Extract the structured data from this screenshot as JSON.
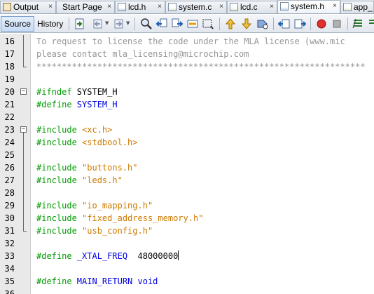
{
  "tabs": [
    {
      "label": "Output",
      "icon": "output-window-icon",
      "active": false
    },
    {
      "label": "Start Page",
      "icon": "",
      "active": false
    },
    {
      "label": "lcd.h",
      "icon": "header-file-icon",
      "active": false
    },
    {
      "label": "system.c",
      "icon": "c-file-icon",
      "active": false
    },
    {
      "label": "lcd.c",
      "icon": "c-file-icon",
      "active": false
    },
    {
      "label": "system.h",
      "icon": "header-file-icon",
      "active": true
    },
    {
      "label": "app_",
      "icon": "c-file-icon",
      "active": false
    }
  ],
  "tab_close_glyph": "×",
  "toolbar": {
    "source_label": "Source",
    "history_label": "History",
    "buttons": [
      "last-edit-icon",
      "back-icon",
      "forward-icon",
      "find-icon",
      "find-previous-icon",
      "find-next-icon",
      "find-selection-icon",
      "toggle-highlight-icon",
      "previous-bookmark-icon",
      "next-bookmark-icon",
      "toggle-bookmark-icon",
      "shift-left-icon",
      "shift-right-icon",
      "start-macro-icon",
      "stop-macro-icon",
      "comment-icon"
    ]
  },
  "editor": {
    "lines": [
      {
        "n": "16",
        "tokens": [
          {
            "t": "cmt",
            "v": "To request to license the code under the MLA license (www.mic"
          }
        ]
      },
      {
        "n": "17",
        "tokens": [
          {
            "t": "cmt",
            "v": "please contact mla_licensing@microchip.com"
          }
        ]
      },
      {
        "n": "18",
        "tokens": [
          {
            "t": "cmt",
            "v": "*****************************************************************"
          }
        ],
        "fold": "end"
      },
      {
        "n": "19",
        "tokens": []
      },
      {
        "n": "20",
        "tokens": [
          {
            "t": "pp",
            "v": "#ifndef "
          },
          {
            "t": "id",
            "v": "SYSTEM_H"
          }
        ],
        "fold": "start"
      },
      {
        "n": "21",
        "tokens": [
          {
            "t": "pp",
            "v": "#define "
          },
          {
            "t": "mac",
            "v": "SYSTEM_H"
          }
        ]
      },
      {
        "n": "22",
        "tokens": []
      },
      {
        "n": "23",
        "tokens": [
          {
            "t": "pp",
            "v": "#include "
          },
          {
            "t": "str",
            "v": "<xc.h>"
          }
        ],
        "fold": "start"
      },
      {
        "n": "24",
        "tokens": [
          {
            "t": "pp",
            "v": "#include "
          },
          {
            "t": "str",
            "v": "<stdbool.h>"
          }
        ]
      },
      {
        "n": "25",
        "tokens": []
      },
      {
        "n": "26",
        "tokens": [
          {
            "t": "pp",
            "v": "#include "
          },
          {
            "t": "str",
            "v": "\"buttons.h\""
          }
        ]
      },
      {
        "n": "27",
        "tokens": [
          {
            "t": "pp",
            "v": "#include "
          },
          {
            "t": "str",
            "v": "\"leds.h\""
          }
        ]
      },
      {
        "n": "28",
        "tokens": []
      },
      {
        "n": "29",
        "tokens": [
          {
            "t": "pp",
            "v": "#include "
          },
          {
            "t": "str",
            "v": "\"io_mapping.h\""
          }
        ]
      },
      {
        "n": "30",
        "tokens": [
          {
            "t": "pp",
            "v": "#include "
          },
          {
            "t": "str",
            "v": "\"fixed_address_memory.h\""
          }
        ]
      },
      {
        "n": "31",
        "tokens": [
          {
            "t": "pp",
            "v": "#include "
          },
          {
            "t": "str",
            "v": "\"usb_config.h\""
          }
        ],
        "fold": "end"
      },
      {
        "n": "32",
        "tokens": []
      },
      {
        "n": "33",
        "tokens": [
          {
            "t": "pp",
            "v": "#define "
          },
          {
            "t": "mac",
            "v": "_XTAL_FREQ"
          },
          {
            "t": "num",
            "v": "  48000000"
          }
        ],
        "cursor": true
      },
      {
        "n": "34",
        "tokens": []
      },
      {
        "n": "35",
        "tokens": [
          {
            "t": "pp",
            "v": "#define "
          },
          {
            "t": "mac",
            "v": "MAIN_RETURN"
          },
          {
            "t": "kw",
            "v": " void"
          }
        ]
      },
      {
        "n": "36",
        "tokens": []
      }
    ]
  },
  "colors": {
    "comment": "#969696",
    "preprocessor": "#009b00",
    "macro": "#0000e6",
    "string": "#ce7b00"
  }
}
